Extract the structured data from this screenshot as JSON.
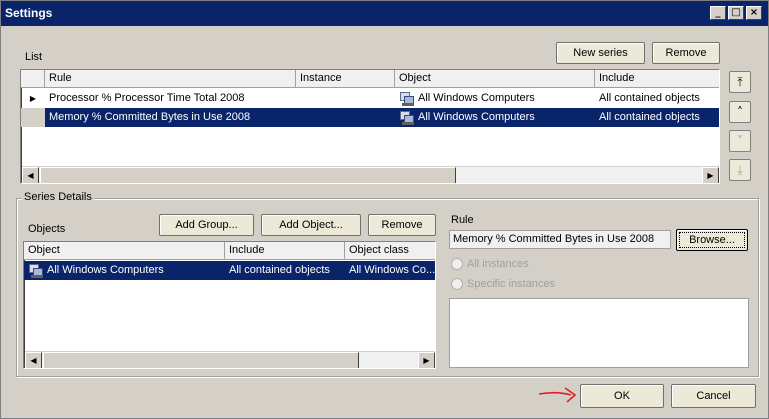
{
  "window": {
    "title": "Settings"
  },
  "titlebar": {
    "minimize": "_",
    "maximize": "□",
    "close": "×"
  },
  "list": {
    "label": "List",
    "new_series_label": "New series",
    "remove_label": "Remove",
    "columns": [
      "Rule",
      "Instance",
      "Object",
      "Include"
    ],
    "rows": [
      {
        "rule": "Processor % Processor Time Total 2008",
        "instance": "",
        "object": "All Windows Computers",
        "include": "All contained objects",
        "selected": false
      },
      {
        "rule": "Memory % Committed Bytes in Use 2008",
        "instance": "",
        "object": "All Windows Computers",
        "include": "All contained objects",
        "selected": true
      }
    ]
  },
  "move_buttons": {
    "top": "⤒",
    "up": "˄",
    "down": "˅",
    "bottom": "⤓"
  },
  "series_details": {
    "title": "Series Details",
    "objects_label": "Objects",
    "add_group_label": "Add Group...",
    "add_object_label": "Add Object...",
    "remove_label": "Remove",
    "columns": [
      "Object",
      "Include",
      "Object class"
    ],
    "rows": [
      {
        "object": "All Windows Computers",
        "include": "All contained objects",
        "object_class": "All Windows Co..."
      }
    ],
    "rule_label": "Rule",
    "rule_value": "Memory % Committed Bytes in Use 2008",
    "browse_label": "Browse...",
    "all_instances_label": "All instances",
    "specific_instances_label": "Specific instances"
  },
  "footer": {
    "ok_label": "OK",
    "cancel_label": "Cancel"
  },
  "colors": {
    "selection": "#0a246a",
    "annotation_arrow": "#e02020"
  }
}
